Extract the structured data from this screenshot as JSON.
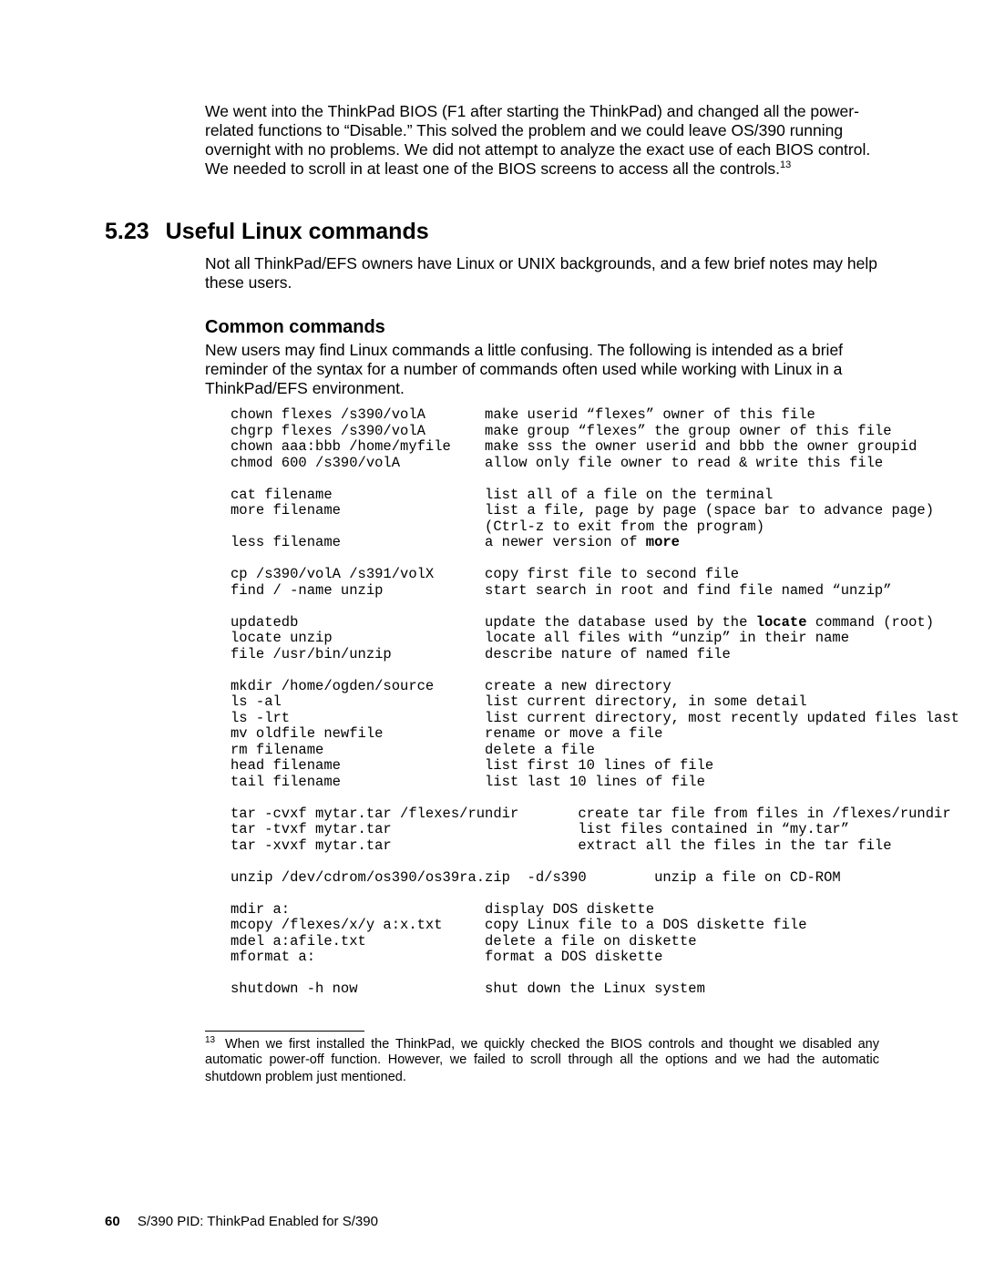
{
  "intro": "We went into the ThinkPad BIOS (F1 after starting the ThinkPad) and changed all the power-related functions to “Disable.”  This solved the problem and we could leave OS/390 running overnight with no problems.  We did not attempt to analyze the exact use of each BIOS control.  We needed to scroll in at least one of the BIOS screens to access all the controls.",
  "intro_footref": "13",
  "section_number": "5.23",
  "section_title": "Useful Linux commands",
  "section_para": "Not all ThinkPad/EFS owners have Linux or UNIX backgrounds, and a few brief notes may help these users.",
  "subheading": "Common commands",
  "sub_para": "New users may find Linux commands a little confusing.  The following is intended as a brief reminder of the syntax for a number of commands often used while working with Linux in a ThinkPad/EFS environment.",
  "code": "chown flexes /s390/volA       make userid “flexes” owner of this file\nchgrp flexes /s390/volA       make group “flexes” the group owner of this file\nchown aaa:bbb /home/myfile    make sss the owner userid and bbb the owner groupid\nchmod 600 /s390/volA          allow only file owner to read & write this file\n\ncat filename                  list all of a file on the terminal\nmore filename                 list a file, page by page (space bar to advance page)\n                              (Ctrl-z to exit from the program)\nless filename                 a newer version of <strong>more</strong>\n\ncp /s390/volA /s391/volX      copy first file to second file\nfind / -name unzip            start search in root and find file named “unzip”\n\nupdatedb                      update the database used by the <strong>locate</strong> command (root)\nlocate unzip                  locate all files with “unzip” in their name\nfile /usr/bin/unzip           describe nature of named file\n\nmkdir /home/ogden/source      create a new directory\nls -al                        list current directory, in some detail\nls -lrt                       list current directory, most recently updated files last\nmv oldfile newfile            rename or move a file\nrm filename                   delete a file\nhead filename                 list first 10 lines of file\ntail filename                 list last 10 lines of file\n\ntar -cvxf mytar.tar /flexes/rundir       create tar file from files in /flexes/rundir\ntar -tvxf mytar.tar                      list files contained in “my.tar”\ntar -xvxf mytar.tar                      extract all the files in the tar file\n\nunzip /dev/cdrom/os390/os39ra.zip  -d/s390        unzip a file on CD-ROM\n\nmdir a:                       display DOS diskette\nmcopy /flexes/x/y a:x.txt     copy Linux file to a DOS diskette file\nmdel a:afile.txt              delete a file on diskette\nmformat a:                    format a DOS diskette\n\nshutdown -h now               shut down the Linux system",
  "footnote_ref": "13",
  "footnote_text": "When we first installed the ThinkPad, we quickly checked the BIOS controls and thought we disabled any automatic power-off function.  However, we failed to scroll through all the options and we had the automatic shutdown problem just mentioned.",
  "page_number": "60",
  "running_footer": "S/390 PID: ThinkPad Enabled for S/390"
}
